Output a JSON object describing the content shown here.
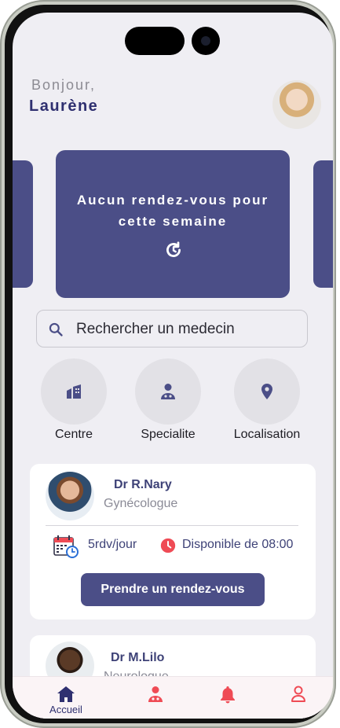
{
  "greeting": "Bonjour,",
  "user_name": "Laurène",
  "banner": {
    "line1": "Aucun rendez-vous pour",
    "line2": "cette semaine"
  },
  "search": {
    "placeholder": "Rechercher un medecin"
  },
  "categories": [
    {
      "label": "Centre",
      "icon": "building-icon"
    },
    {
      "label": "Specialite",
      "icon": "doctor-icon"
    },
    {
      "label": "Localisation",
      "icon": "location-pin-icon"
    }
  ],
  "doctors": [
    {
      "name": "Dr R.Nary",
      "specialty": "Gynécologue",
      "rdv": "5rdv/jour",
      "availability": "Disponible de 08:00",
      "cta": "Prendre un rendez-vous"
    },
    {
      "name": "Dr M.Lilo",
      "specialty": "Neurologue"
    }
  ],
  "bottom_nav": [
    {
      "label": "Accueil",
      "icon": "home-icon",
      "active": true
    },
    {
      "label": "",
      "icon": "doctor-icon"
    },
    {
      "label": "",
      "icon": "bell-icon"
    },
    {
      "label": "",
      "icon": "profile-icon"
    }
  ],
  "colors": {
    "primary": "#4b4e87",
    "accent_red": "#ef4b55",
    "background": "#efeef3"
  }
}
